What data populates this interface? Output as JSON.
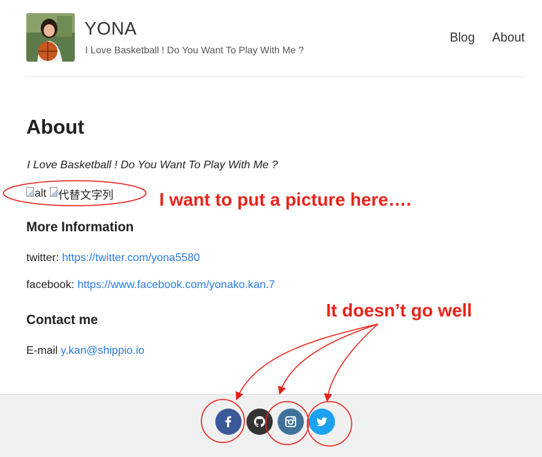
{
  "header": {
    "site_title": "YONA",
    "site_description": "I Love Basketball ! Do You Want To Play With Me ?",
    "nav": [
      {
        "label": "Blog"
      },
      {
        "label": "About"
      }
    ]
  },
  "main": {
    "page_title": "About",
    "subtitle": "I Love Basketball ! Do You Want To Play With Me ?",
    "broken_images": [
      {
        "alt": "alt"
      },
      {
        "alt": "代替文字列"
      }
    ],
    "more_info": {
      "heading": "More Information",
      "twitter_label": "twitter:",
      "twitter_link": "https://twitter.com/yona5580",
      "facebook_label": "facebook:",
      "facebook_link": "https://www.facebook.com/yonako.kan.7"
    },
    "contact": {
      "heading": "Contact me",
      "email_label": "E-mail",
      "email_link": "y.kan@shippio.io"
    }
  },
  "footer": {
    "social_icons": [
      {
        "icon": "facebook-icon",
        "color": "#3b5998"
      },
      {
        "icon": "github-icon",
        "color": "#333333"
      },
      {
        "icon": "instagram-icon",
        "color": "#3f729b"
      },
      {
        "icon": "twitter-icon",
        "color": "#1da1f2"
      }
    ]
  },
  "annotations": {
    "picture_note": "I want to put a picture here….",
    "icons_note": "It doesn’t go well",
    "color": "#e8231a"
  }
}
